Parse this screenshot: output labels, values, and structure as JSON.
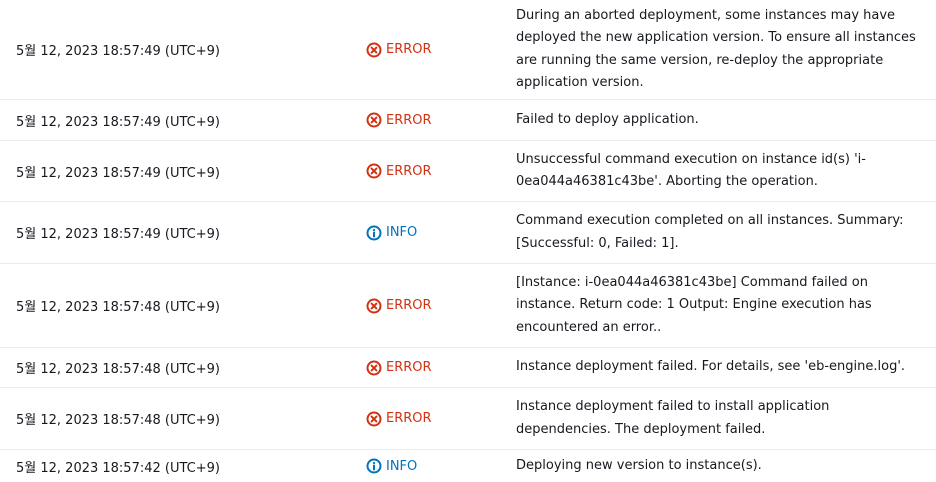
{
  "events": [
    {
      "time": "5월 12, 2023 18:57:49 (UTC+9)",
      "type": "ERROR",
      "level": "error",
      "details": "During an aborted deployment, some instances may have deployed the new application version. To ensure all instances are running the same version, re-deploy the appropriate application version."
    },
    {
      "time": "5월 12, 2023 18:57:49 (UTC+9)",
      "type": "ERROR",
      "level": "error",
      "details": "Failed to deploy application."
    },
    {
      "time": "5월 12, 2023 18:57:49 (UTC+9)",
      "type": "ERROR",
      "level": "error",
      "details": "Unsuccessful command execution on instance id(s) 'i-0ea044a46381c43be'. Aborting the operation."
    },
    {
      "time": "5월 12, 2023 18:57:49 (UTC+9)",
      "type": "INFO",
      "level": "info",
      "details": "Command execution completed on all instances. Summary: [Successful: 0, Failed: 1]."
    },
    {
      "time": "5월 12, 2023 18:57:48 (UTC+9)",
      "type": "ERROR",
      "level": "error",
      "details": "[Instance: i-0ea044a46381c43be] Command failed on instance. Return code: 1 Output: Engine execution has encountered an error.."
    },
    {
      "time": "5월 12, 2023 18:57:48 (UTC+9)",
      "type": "ERROR",
      "level": "error",
      "details": "Instance deployment failed. For details, see 'eb-engine.log'."
    },
    {
      "time": "5월 12, 2023 18:57:48 (UTC+9)",
      "type": "ERROR",
      "level": "error",
      "details": "Instance deployment failed to install application dependencies. The deployment failed."
    },
    {
      "time": "5월 12, 2023 18:57:42 (UTC+9)",
      "type": "INFO",
      "level": "info",
      "details": "Deploying new version to instance(s)."
    }
  ],
  "colors": {
    "error": "#d13212",
    "info": "#0073bb",
    "divider": "#e9ebed",
    "text": "#16191f"
  },
  "icons": {
    "error": "error-circle-x-icon",
    "info": "info-circle-icon"
  }
}
